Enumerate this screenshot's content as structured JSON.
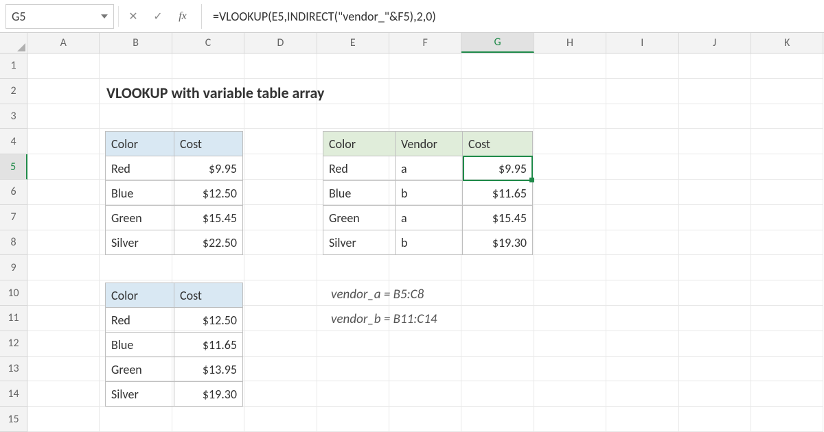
{
  "namebox": {
    "value": "G5"
  },
  "formula_bar": {
    "cancel_glyph": "✕",
    "enter_glyph": "✓",
    "fx_label": "fx",
    "formula": "=VLOOKUP(E5,INDIRECT(\"vendor_\"&F5),2,0)"
  },
  "columns": [
    "A",
    "B",
    "C",
    "D",
    "E",
    "F",
    "G",
    "H",
    "I",
    "J",
    "K"
  ],
  "selected_column_index": 6,
  "rows": [
    "1",
    "2",
    "3",
    "4",
    "5",
    "6",
    "7",
    "8",
    "9",
    "10",
    "11",
    "12",
    "13",
    "14",
    "15"
  ],
  "selected_row_index": 4,
  "title": "VLOOKUP with variable table array",
  "table1": {
    "headers": [
      "Color",
      "Cost"
    ],
    "rows": [
      [
        "Red",
        "$9.95"
      ],
      [
        "Blue",
        "$12.50"
      ],
      [
        "Green",
        "$15.45"
      ],
      [
        "Silver",
        "$22.50"
      ]
    ]
  },
  "table2": {
    "headers": [
      "Color",
      "Cost"
    ],
    "rows": [
      [
        "Red",
        "$12.50"
      ],
      [
        "Blue",
        "$11.65"
      ],
      [
        "Green",
        "$13.95"
      ],
      [
        "Silver",
        "$19.30"
      ]
    ]
  },
  "table3": {
    "headers": [
      "Color",
      "Vendor",
      "Cost"
    ],
    "rows": [
      [
        "Red",
        "a",
        "$9.95"
      ],
      [
        "Blue",
        "b",
        "$11.65"
      ],
      [
        "Green",
        "a",
        "$15.45"
      ],
      [
        "Silver",
        "b",
        "$19.30"
      ]
    ]
  },
  "notes": {
    "line1": "vendor_a = B5:C8",
    "line2": "vendor_b = B11:C14"
  },
  "selection": {
    "cell": "G5"
  }
}
